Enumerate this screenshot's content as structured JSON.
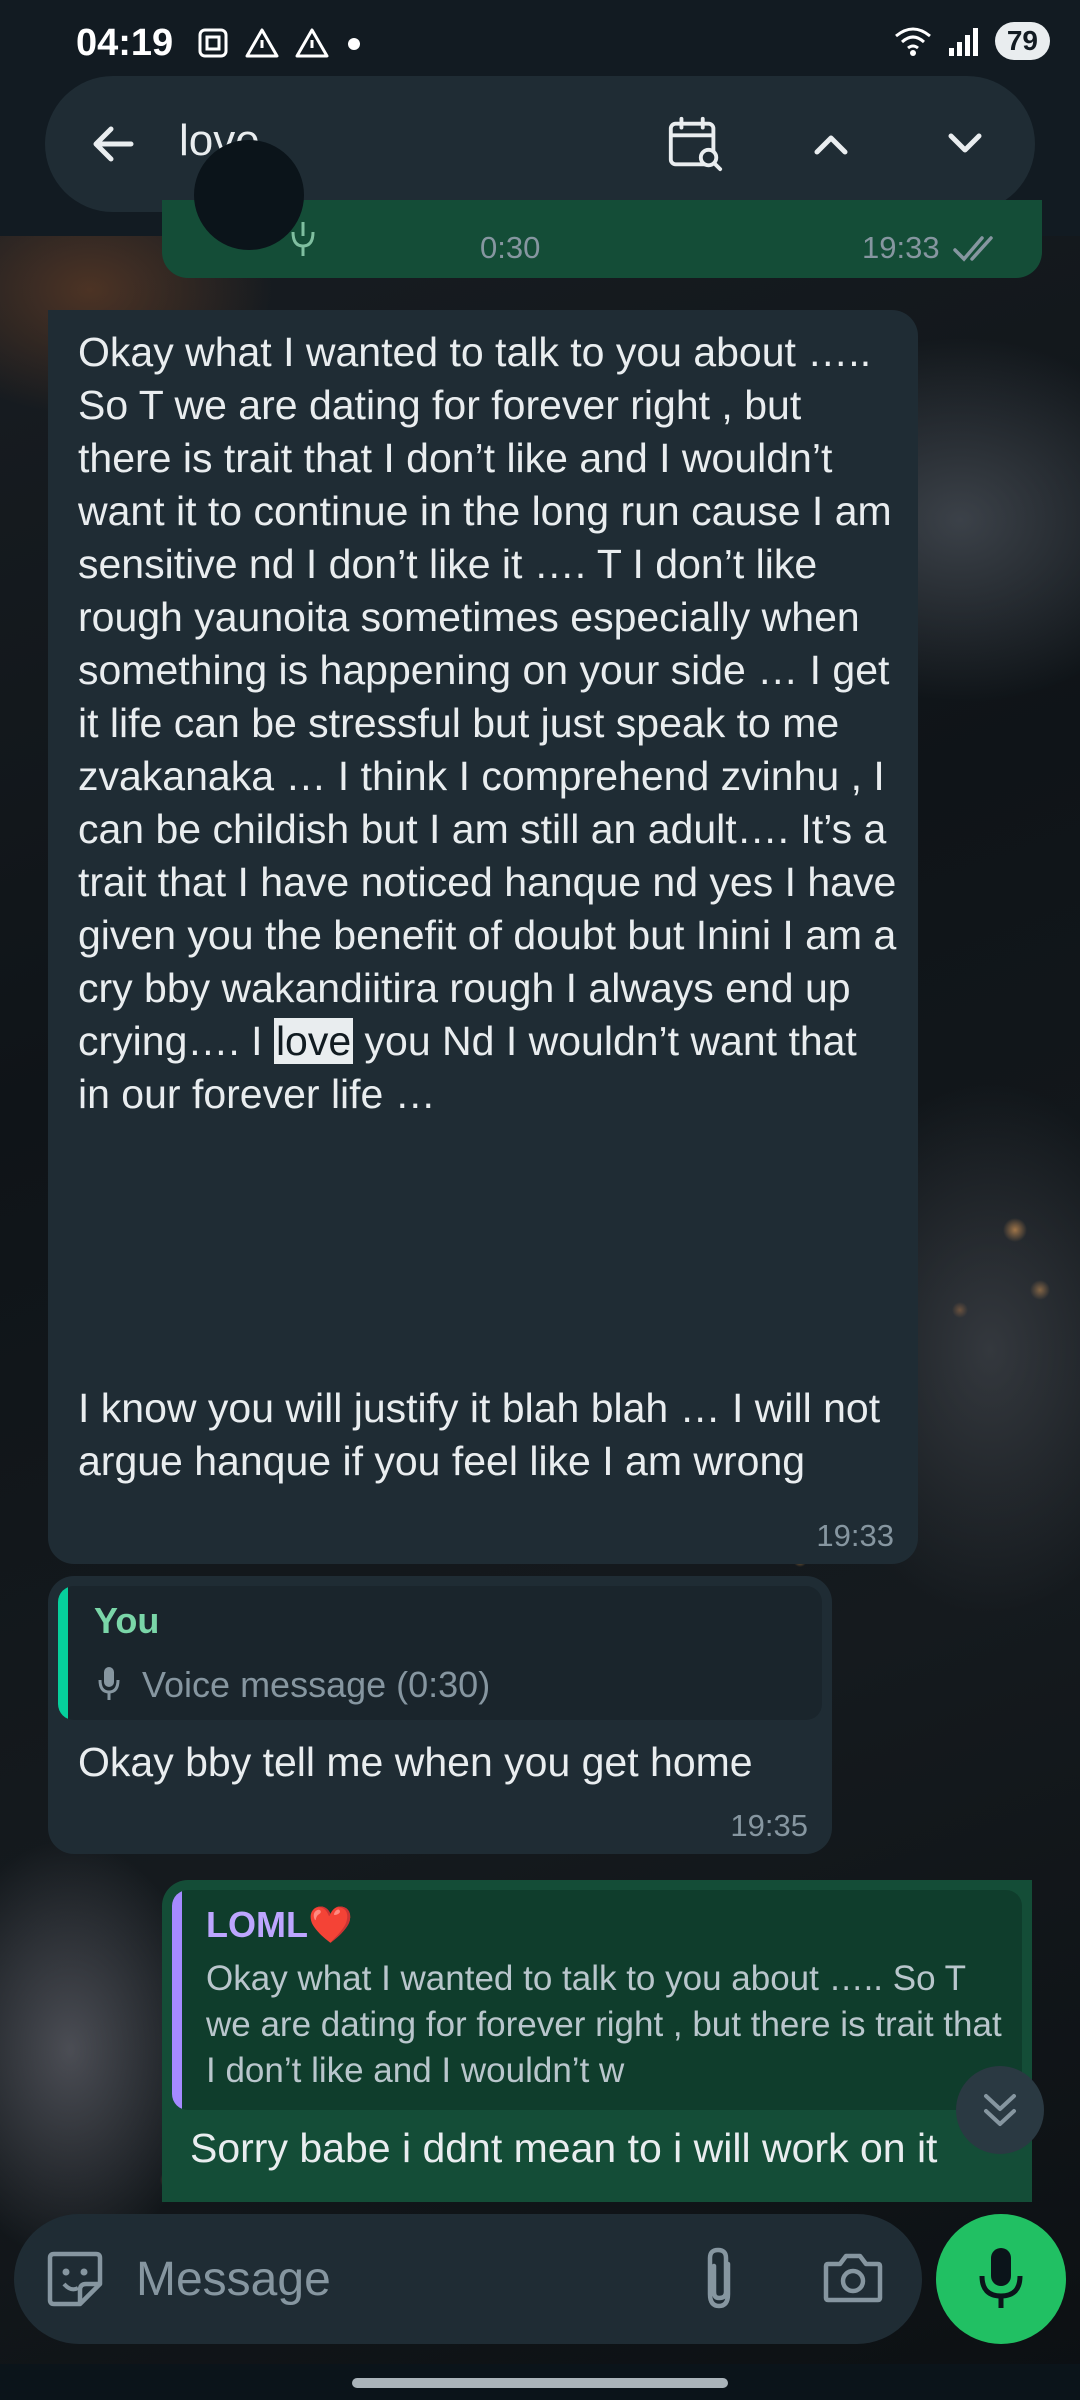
{
  "status_bar": {
    "time": "04:19",
    "battery": "79",
    "icons": [
      "screenshot-icon",
      "warning-icon",
      "warning-icon",
      "dot-icon",
      "wifi-icon",
      "signal-icon",
      "battery-icon"
    ]
  },
  "search": {
    "query": "love",
    "icons": [
      "back-arrow-icon",
      "calendar-search-icon",
      "chevron-up-icon",
      "chevron-down-icon"
    ]
  },
  "messages": {
    "voice_top": {
      "duration": "0:30",
      "time": "19:33"
    },
    "long_message": {
      "para1_before": "Okay what I wanted to talk to you about ….. So T we are dating for forever right , but there is trait that I don’t like and I wouldn’t want it to continue in the long run cause I am  sensitive nd I don’t like it …. T I don’t like rough yaunoita sometimes especially when something is happening on your side … I get it life can be stressful but just speak to me zvakanaka … I think I comprehend zvinhu , I can be childish but I am still an adult…. It’s a trait that I have noticed hanque nd yes I have given you the benefit of doubt but Inini I am a cry bby wakandiitira rough I always end up crying…. I ",
      "highlight": "love",
      "para1_after": " you Nd I wouldn’t want that in our forever life …",
      "para2": "I know you will justify it blah blah … I will not argue hanque if you feel like I am wrong",
      "time": "19:33"
    },
    "reply_in": {
      "quote_author": "You",
      "quote_text": "Voice message (0:30)",
      "text": "Okay bby tell me when you get home",
      "time": "19:35"
    },
    "reply_out": {
      "quote_author": "LOML❤️",
      "quote_text": "Okay what I wanted to talk to you about ….. So T we are dating for forever right , but there is trait that I don’t like and I wouldn’t w",
      "text": "Sorry babe i ddnt mean to i will work on it"
    }
  },
  "input": {
    "placeholder": "Message"
  },
  "colors": {
    "incoming_bubble": "#1f2c34",
    "outgoing_bubble": "#144d37",
    "accent_green": "#21c063",
    "quote_you": "#06cf9c",
    "quote_loml": "#a58aff"
  }
}
